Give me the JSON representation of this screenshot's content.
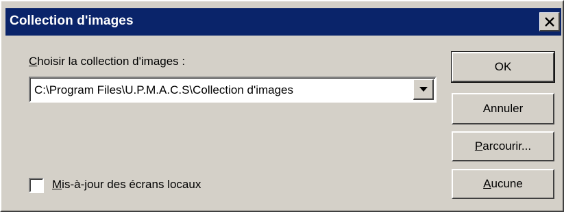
{
  "window": {
    "title": "Collection d'images",
    "close_icon": "close-icon"
  },
  "main": {
    "collection_label_accel": "C",
    "collection_label_rest": "hoisir la collection d'images :",
    "collection_value": "C:\\Program Files\\U.P.M.A.C.S\\Collection d'images",
    "checkbox_label_accel": "M",
    "checkbox_label_rest": "is-à-jour des écrans locaux",
    "checkbox_checked": false
  },
  "buttons": {
    "ok": "OK",
    "cancel": "Annuler",
    "browse_accel": "P",
    "browse_rest": "arcourir...",
    "none_accel": "A",
    "none_rest": "ucune"
  },
  "colors": {
    "titlebar": "#0a246a",
    "face": "#d4d0c8"
  }
}
